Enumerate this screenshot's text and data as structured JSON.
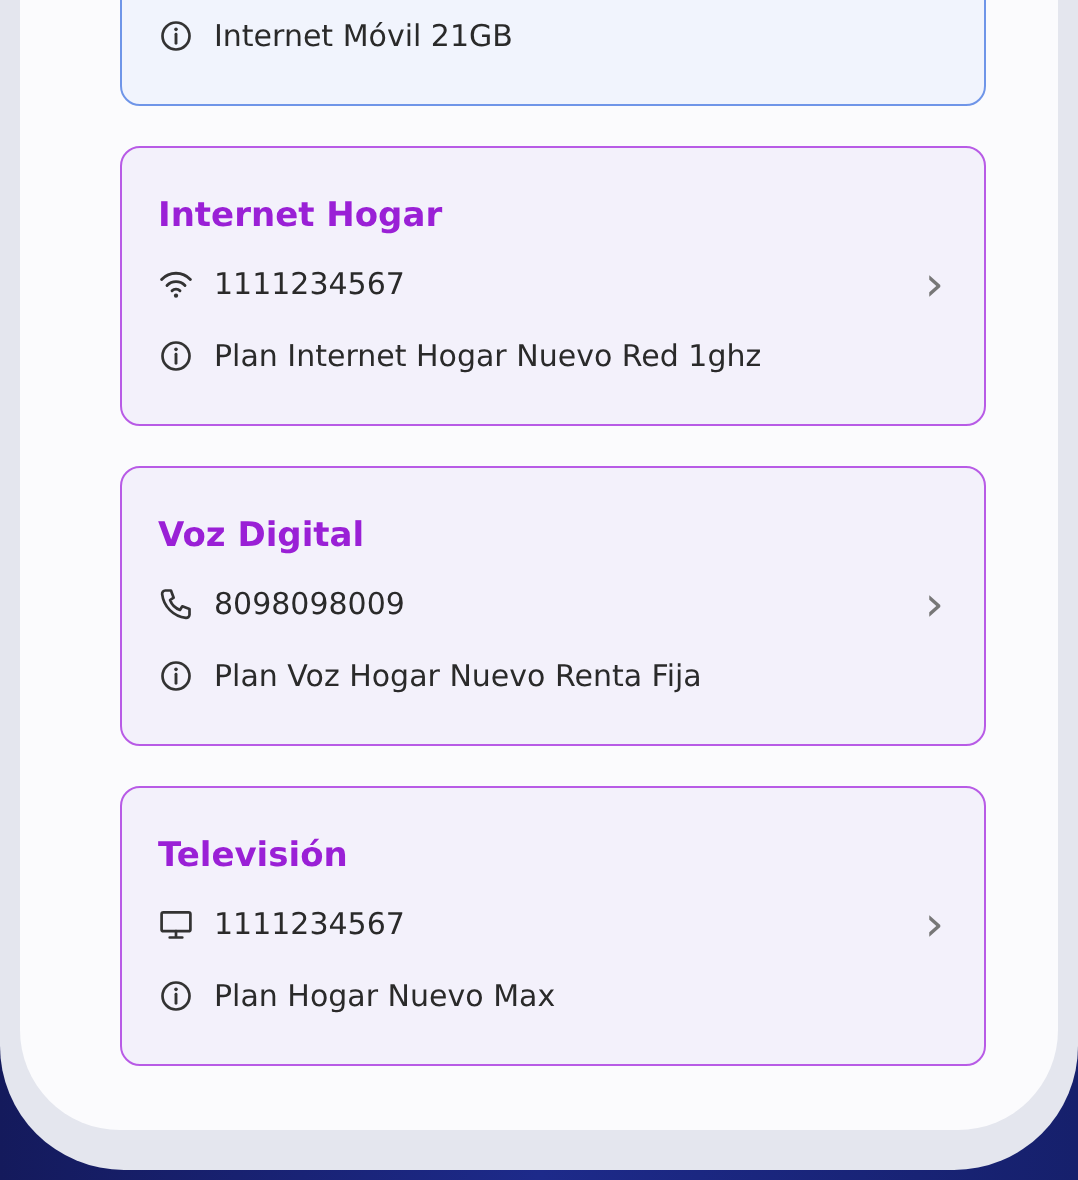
{
  "services": [
    {
      "selected": true,
      "info": "Internet Móvil 21GB"
    },
    {
      "kind": "internet",
      "selected": false,
      "title": "Internet Hogar",
      "number": "1111234567",
      "chevron": "›",
      "info": "Plan Internet Hogar Nuevo Red 1ghz"
    },
    {
      "kind": "voice",
      "selected": false,
      "title": "Voz Digital",
      "number": "8098098009",
      "chevron": "›",
      "info": "Plan Voz Hogar Nuevo Renta Fija"
    },
    {
      "kind": "tv",
      "selected": false,
      "title": "Televisión",
      "number": "1111234567",
      "chevron": "›",
      "info": "Plan Hogar Nuevo Max"
    }
  ]
}
